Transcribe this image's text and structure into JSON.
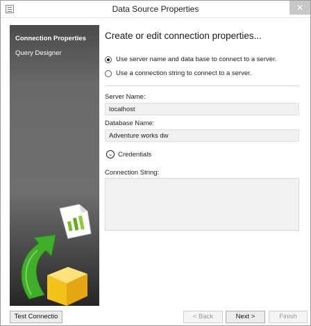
{
  "window": {
    "title": "Data Source Properties",
    "close_glyph": "✕"
  },
  "sidebar": {
    "items": [
      {
        "label": "Connection Properties",
        "active": true
      },
      {
        "label": "Query Designer",
        "active": false
      }
    ]
  },
  "main": {
    "heading": "Create or edit connection properties...",
    "options": [
      {
        "label": "Use server name and data base to connect to a server.",
        "selected": true
      },
      {
        "label": "Use a connection string to connect to a server.",
        "selected": false
      }
    ],
    "server_name_label": "Server Name:",
    "server_name_value": "localhost",
    "database_name_label": "Database Name:",
    "database_name_value": "Adventure works dw",
    "credentials_label": "Credentials",
    "connection_string_label": "Connection String:",
    "connection_string_value": ""
  },
  "footer": {
    "test_connection_label": "Test Connectio",
    "back_label": "< Back",
    "next_label": "Next >",
    "finish_label": "Finish"
  },
  "colors": {
    "arrow_green": "#3fae2a",
    "cube_yellow": "#f3c21b",
    "chart_green": "#7cbb2a"
  }
}
